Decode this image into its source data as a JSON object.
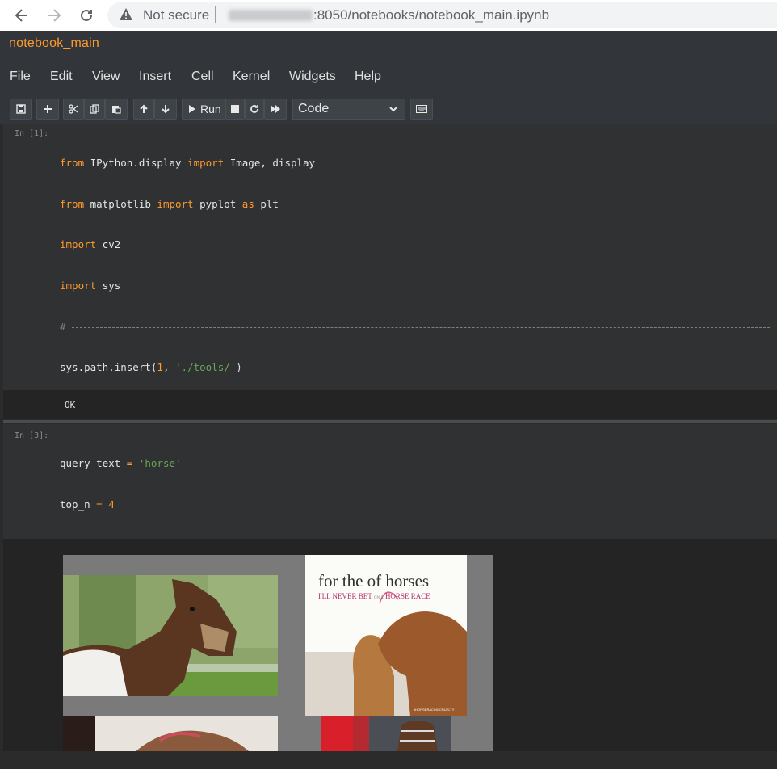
{
  "browser": {
    "security_label": "Not secure",
    "url_path": ":8050/notebooks/notebook_main.ipynb"
  },
  "notebook": {
    "title": "notebook_main",
    "menu": [
      "File",
      "Edit",
      "View",
      "Insert",
      "Cell",
      "Kernel",
      "Widgets",
      "Help"
    ],
    "toolbar": {
      "run_label": "Run",
      "cell_type": "Code"
    }
  },
  "cells": [
    {
      "prompt": "In [1]:",
      "output": "OK"
    },
    {
      "prompt": "In [3]:"
    }
  ],
  "thumbnails": {
    "poster_title_a": "for the",
    "poster_title_heart": "of",
    "poster_title_b": "horses",
    "poster_sub_a": "I'LL NEVER BET",
    "poster_sub_small": "ON A",
    "poster_sub_b": "HORSE RACE",
    "poster_tag": "#HORSERACINGCRUELTY"
  },
  "colors": {
    "accent": "#ff9a2e",
    "string": "#6aa855",
    "comment": "#7f7f7f"
  }
}
